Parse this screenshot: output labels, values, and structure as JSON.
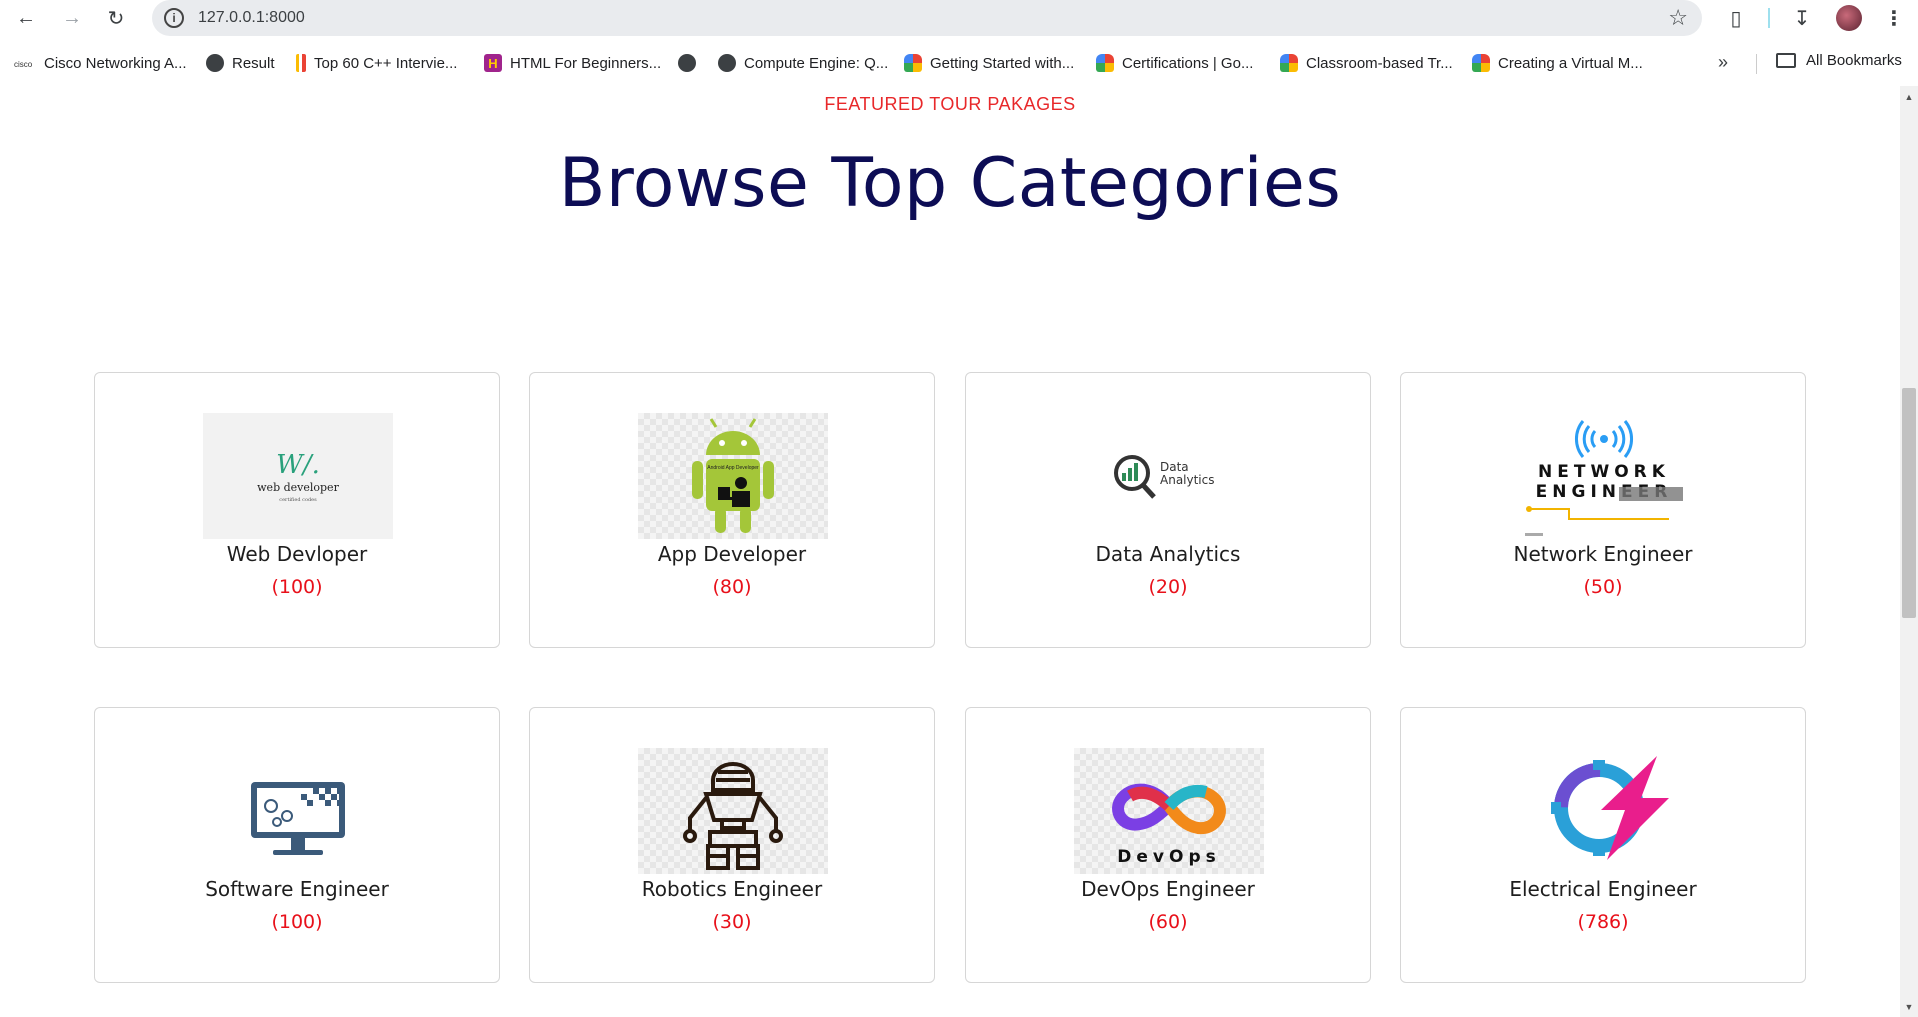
{
  "browser": {
    "url": "127.0.0.1:8000",
    "bookmarks": [
      {
        "label": "Cisco Networking A...",
        "icon": "cisco-icon"
      },
      {
        "label": "Result",
        "icon": "globe-icon"
      },
      {
        "label": "Top 60 C++ Intervie...",
        "icon": "chart-bar-icon"
      },
      {
        "label": "HTML For Beginners...",
        "icon": "h-icon"
      },
      {
        "label": "",
        "icon": "globe-icon"
      },
      {
        "label": "Compute Engine: Q...",
        "icon": "globe-icon"
      },
      {
        "label": "Getting Started with...",
        "icon": "google-cloud-icon"
      },
      {
        "label": "Certifications | Go...",
        "icon": "google-cloud-icon"
      },
      {
        "label": "Classroom-based Tr...",
        "icon": "google-cloud-icon"
      },
      {
        "label": "Creating a Virtual M...",
        "icon": "google-cloud-icon"
      }
    ],
    "all_bookmarks": "All Bookmarks"
  },
  "page": {
    "featured": "FEATURED TOUR PAKAGES",
    "heading": "Browse Top Categories",
    "categories": [
      {
        "title": "Web Devloper",
        "count": "(100)",
        "image": "web-developer-logo"
      },
      {
        "title": "App Developer",
        "count": "(80)",
        "image": "android-logo"
      },
      {
        "title": "Data Analytics",
        "count": "(20)",
        "image": "data-analytics-logo"
      },
      {
        "title": "Network Engineer",
        "count": "(50)",
        "image": "network-engineer-logo"
      },
      {
        "title": "Software Engineer",
        "count": "(100)",
        "image": "software-engineer-icon"
      },
      {
        "title": "Robotics Engineer",
        "count": "(30)",
        "image": "robot-icon"
      },
      {
        "title": "DevOps Engineer",
        "count": "(60)",
        "image": "devops-logo"
      },
      {
        "title": "Electrical Engineer",
        "count": "(786)",
        "image": "electrical-logo"
      }
    ],
    "logo_text": {
      "web_dev_mark": "W/.",
      "web_dev_name": "web developer",
      "web_dev_sub": "certified codes",
      "data_analytics_line1": "Data",
      "data_analytics_line2": "Analytics",
      "network_line1": "NETWORK",
      "network_line2": "ENGINEER",
      "devops": "DevOps",
      "android_caption": "Android App Developer"
    }
  },
  "colors": {
    "accent_red": "#e8282a",
    "heading_navy": "#0d0d55",
    "count_red": "#e8101a"
  }
}
